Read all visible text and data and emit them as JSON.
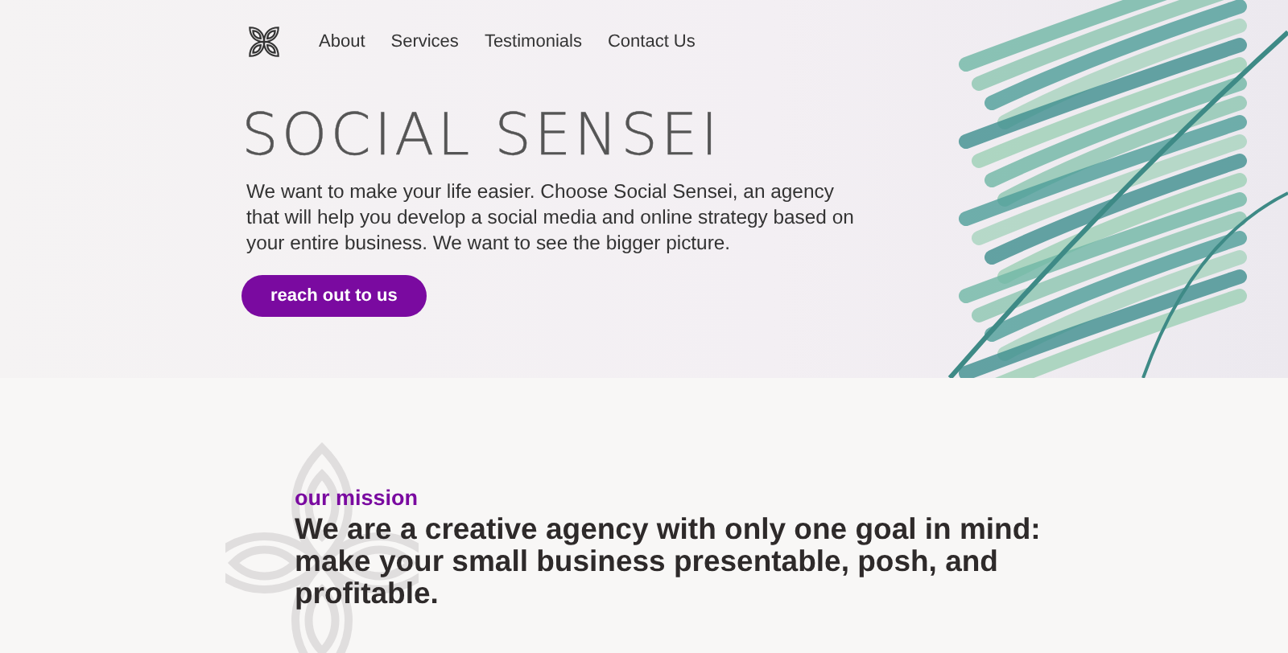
{
  "nav": {
    "links": [
      "About",
      "Services",
      "Testimonials",
      "Contact Us"
    ]
  },
  "hero": {
    "title": "SOCIAL SENSEI",
    "text": "We want to make your life easier. Choose Social Sensei, an agency that will help you develop a social media and online strategy based on your entire business. We want to see the bigger picture.",
    "button": "reach out to us"
  },
  "mission": {
    "label": "our mission",
    "heading": "We are a creative agency with only one goal in mind: make your small business presentable, posh, and profitable."
  }
}
